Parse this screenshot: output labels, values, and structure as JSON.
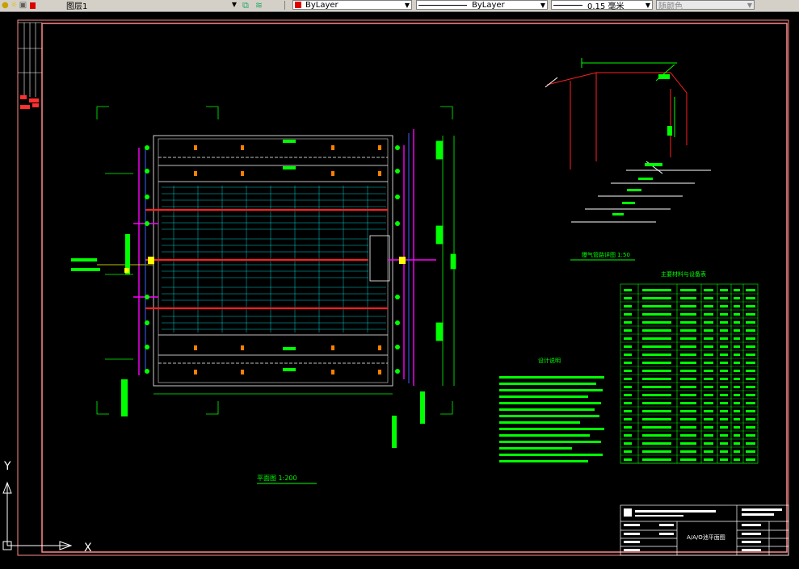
{
  "toolbar": {
    "layer_name": "图层1",
    "color": "ByLayer",
    "linetype": "ByLayer",
    "lineweight": "0.15 毫米",
    "plotstyle": "随颜色"
  },
  "drawing": {
    "plan_title": "平面图  1:200",
    "detail_title": "曝气管路详图  1:50",
    "notes_title": "设计说明",
    "materials_title": "主要材料与设备表",
    "sheet_title": "A/A/O池平面图",
    "axis_y": "Y",
    "axis_x": "X"
  },
  "colors": {
    "frame": "#ff8a8a",
    "green": "#00ff00",
    "red": "#ff0000",
    "cyan": "#00ffff",
    "magenta": "#ff00ff",
    "white": "#ffffff",
    "yellow": "#ffff00"
  }
}
